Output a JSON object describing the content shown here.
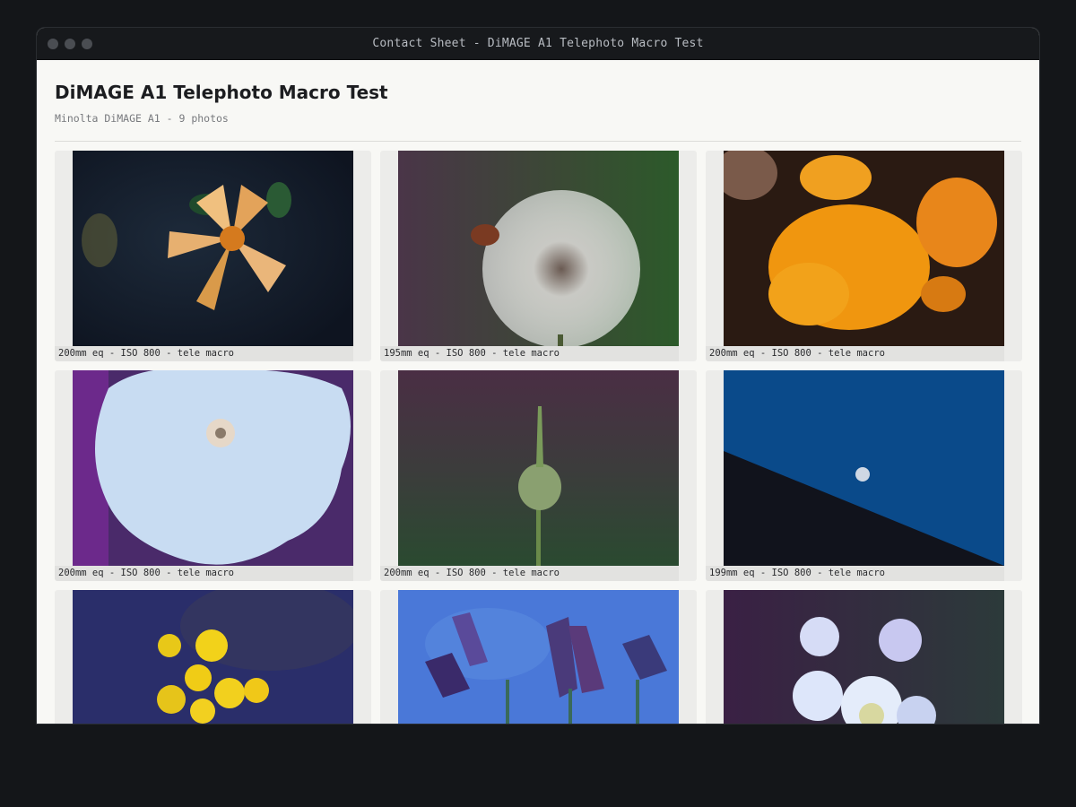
{
  "window": {
    "title": "Contact Sheet - DiMAGE A1 Telephoto Macro Test"
  },
  "header": {
    "title": "DiMAGE A1 Telephoto Macro Test",
    "subtitle": "Minolta DiMAGE A1 - 9 photos"
  },
  "photos": [
    {
      "caption": "200mm eq - ISO 800 - tele macro",
      "subject": "orange lily flower"
    },
    {
      "caption": "195mm eq - ISO 800 - tele macro",
      "subject": "dandelion seed head"
    },
    {
      "caption": "200mm eq - ISO 800 - tele macro",
      "subject": "orange yarrow cluster"
    },
    {
      "caption": "200mm eq - ISO 800 - tele macro",
      "subject": "white petunia"
    },
    {
      "caption": "200mm eq - ISO 800 - tele macro",
      "subject": "allium bud"
    },
    {
      "caption": "199mm eq - ISO 800 - tele macro",
      "subject": "moon over roofline"
    },
    {
      "caption": "",
      "subject": "yellow daisies"
    },
    {
      "caption": "",
      "subject": "blue thistle buds"
    },
    {
      "caption": "",
      "subject": "pale fleabane flowers"
    }
  ]
}
